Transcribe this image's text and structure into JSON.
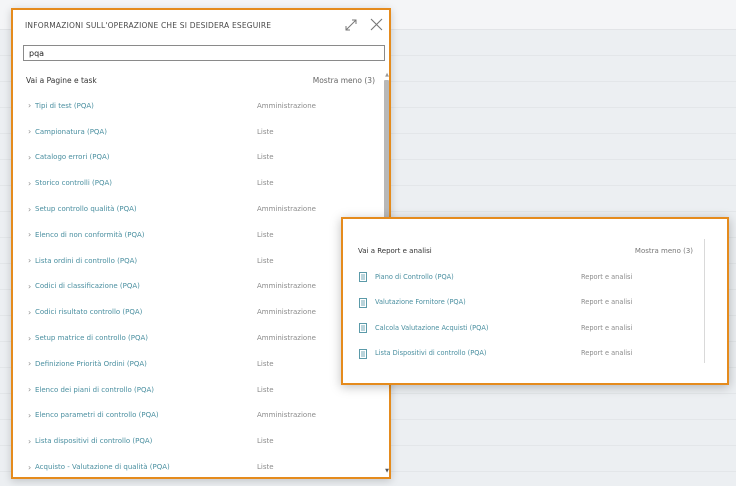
{
  "dialog": {
    "title": "INFORMAZIONI SULL'OPERAZIONE CHE SI DESIDERA ESEGUIRE",
    "search_value": "pqa",
    "section_title": "Vai a Pagine e task",
    "show_less": "Mostra meno (3)",
    "results": [
      {
        "name": "Tipi di test (PQA)",
        "category": "Amministrazione"
      },
      {
        "name": "Campionatura (PQA)",
        "category": "Liste"
      },
      {
        "name": "Catalogo errori (PQA)",
        "category": "Liste"
      },
      {
        "name": "Storico controlli (PQA)",
        "category": "Liste"
      },
      {
        "name": "Setup controllo qualità (PQA)",
        "category": "Amministrazione"
      },
      {
        "name": "Elenco di non conformità (PQA)",
        "category": "Liste"
      },
      {
        "name": "Lista ordini di controllo (PQA)",
        "category": "Liste"
      },
      {
        "name": "Codici di classificazione (PQA)",
        "category": "Amministrazione"
      },
      {
        "name": "Codici risultato controllo (PQA)",
        "category": "Amministrazione"
      },
      {
        "name": "Setup matrice di controllo (PQA)",
        "category": "Amministrazione"
      },
      {
        "name": "Definizione Priorità Ordini (PQA)",
        "category": "Liste"
      },
      {
        "name": "Elenco dei piani di controllo (PQA)",
        "category": "Liste"
      },
      {
        "name": "Elenco parametri di controllo (PQA)",
        "category": "Amministrazione"
      },
      {
        "name": "Lista dispositivi di controllo (PQA)",
        "category": "Liste"
      },
      {
        "name": "Acquisto - Valutazione di qualità (PQA)",
        "category": "Liste"
      }
    ]
  },
  "reports": {
    "section_title": "Vai a Report e analisi",
    "show_less": "Mostra meno (3)",
    "items": [
      {
        "name": "Piano di Controllo (PQA)",
        "category": "Report e analisi"
      },
      {
        "name": "Valutazione Fornitore (PQA)",
        "category": "Report e analisi"
      },
      {
        "name": "Calcola Valutazione Acquisti (PQA)",
        "category": "Report e analisi"
      },
      {
        "name": "Lista Dispositivi di controllo (PQA)",
        "category": "Report e analisi"
      }
    ]
  },
  "icons": {
    "chevron": "chevron-right-icon",
    "document": "document-icon",
    "expand": "expand-icon",
    "close": "close-icon"
  },
  "colors": {
    "highlight_border": "#e58b1d",
    "link": "#4a8fa0",
    "category": "#8b8b8b"
  }
}
